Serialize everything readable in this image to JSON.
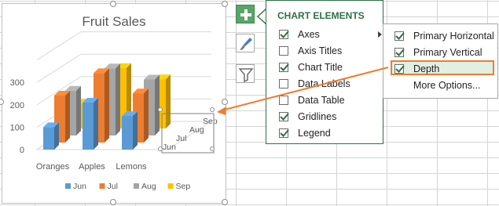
{
  "chart_data": {
    "type": "bar",
    "subtype": "3d-column",
    "title": "Fruit Sales",
    "categories": [
      "Oranges",
      "Apples",
      "Lemons"
    ],
    "depth_axis_labels": [
      "Jun",
      "Jul",
      "Aug",
      "Sep"
    ],
    "series": [
      {
        "name": "Jun",
        "color": "#5b9bd5",
        "values": [
          100,
          210,
          150
        ]
      },
      {
        "name": "Jul",
        "color": "#ed7d31",
        "values": [
          210,
          310,
          220
        ]
      },
      {
        "name": "Aug",
        "color": "#a5a5a5",
        "values": [
          200,
          300,
          250
        ]
      },
      {
        "name": "Sep",
        "color": "#ffc000",
        "values": [
          110,
          270,
          220
        ]
      }
    ],
    "y_ticks": [
      "0",
      "100",
      "200",
      "300"
    ],
    "ylim": [
      0,
      400
    ],
    "grid": true,
    "legend_position": "bottom"
  },
  "chart_elements": {
    "title": "CHART ELEMENTS",
    "items": [
      {
        "label": "Axes",
        "checked": true,
        "has_submenu": true
      },
      {
        "label": "Axis Titles",
        "checked": false
      },
      {
        "label": "Chart Title",
        "checked": true
      },
      {
        "label": "Data Labels",
        "checked": false
      },
      {
        "label": "Data Table",
        "checked": false
      },
      {
        "label": "Gridlines",
        "checked": true
      },
      {
        "label": "Legend",
        "checked": true
      }
    ]
  },
  "axes_submenu": {
    "items": [
      {
        "label": "Primary Horizontal",
        "checked": true
      },
      {
        "label": "Primary Vertical",
        "checked": true
      },
      {
        "label": "Depth",
        "checked": true,
        "highlighted": true
      },
      {
        "label": "More Options...",
        "checked": null
      }
    ]
  },
  "colors": {
    "accent_green": "#2f6f45",
    "button_green": "#5aa469",
    "highlight_orange": "#ed7d31"
  }
}
